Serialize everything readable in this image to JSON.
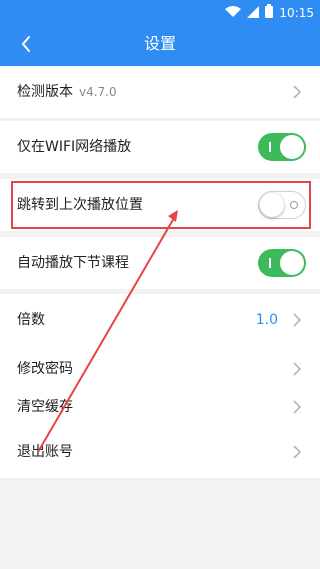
{
  "status_bar": {
    "time": "10:15",
    "icons": [
      "wifi-icon",
      "signal-icon",
      "battery-icon"
    ],
    "color": "#2f8cf2"
  },
  "header": {
    "title": "设置",
    "back_icon": "chevron-left-icon"
  },
  "settings": {
    "check_version": {
      "label": "检测版本",
      "version": "v4.7.0"
    },
    "wifi_only": {
      "label": "仅在WIFI网络播放",
      "enabled": true
    },
    "resume_position": {
      "label": "跳转到上次播放位置",
      "enabled": false
    },
    "autoplay_next": {
      "label": "自动播放下节课程",
      "enabled": true
    },
    "speed": {
      "label": "倍数",
      "value": "1.0"
    },
    "change_password": {
      "label": "修改密码"
    },
    "clear_cache": {
      "label": "清空缓存"
    },
    "logout": {
      "label": "退出账号"
    }
  },
  "colors": {
    "accent": "#2f8cf2",
    "toggle_on": "#3dbb5c",
    "annotation": "#e64545",
    "background": "#f2f2f2"
  }
}
